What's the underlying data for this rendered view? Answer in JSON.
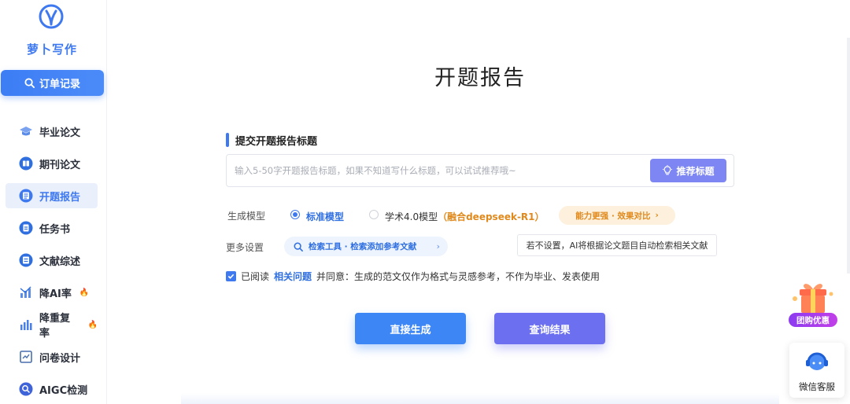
{
  "brand": {
    "name": "萝卜写作"
  },
  "sidebar": {
    "order_button": "订单记录",
    "items": [
      {
        "label": "毕业论文",
        "icon": "graduation-cap-icon"
      },
      {
        "label": "期刊论文",
        "icon": "journal-icon"
      },
      {
        "label": "开题报告",
        "icon": "report-icon",
        "active": true
      },
      {
        "label": "任务书",
        "icon": "task-icon"
      },
      {
        "label": "文献综述",
        "icon": "literature-icon"
      },
      {
        "label": "降AI率",
        "icon": "chart-down-icon",
        "badge": "fire"
      },
      {
        "label": "降重复率",
        "icon": "bar-chart-icon",
        "badge": "fire"
      },
      {
        "label": "问卷设计",
        "icon": "survey-icon"
      },
      {
        "label": "AIGC检测",
        "icon": "aigc-search-icon"
      }
    ]
  },
  "main": {
    "page_title": "开题报告",
    "section_title": "提交开题报告标题",
    "title_input": {
      "value": "",
      "placeholder": "输入5-50字开题报告标题，如果不知道写什么标题，可以试试推荐哦~"
    },
    "recommend_button": "推荐标题",
    "model": {
      "label": "生成模型",
      "options": [
        {
          "label": "标准模型",
          "selected": true
        },
        {
          "label": "学术4.0模型",
          "suffix": "（融合deepseek-R1）",
          "selected": false
        }
      ],
      "compare_pill": "能力更强 · 效果对比",
      "compare_chevron": "›"
    },
    "more_settings": {
      "label": "更多设置",
      "tool_pill": "检索工具 · 检索添加参考文献",
      "tool_chevron": "›",
      "hint": "若不设置，AI将根据论文题目自动检索相关文献"
    },
    "agreement": {
      "checked": true,
      "prefix": "已阅读",
      "link": "相关问题",
      "suffix": "并同意：生成的范文仅作为格式与灵感参考，不作为毕业、发表使用"
    },
    "buttons": {
      "generate": "直接生成",
      "query": "查询结果"
    }
  },
  "float": {
    "promo": "团购优惠",
    "service": "微信客服"
  },
  "colors": {
    "primary": "#3f79f0",
    "purple": "#6c6ff0",
    "orange": "#e08a1e"
  }
}
